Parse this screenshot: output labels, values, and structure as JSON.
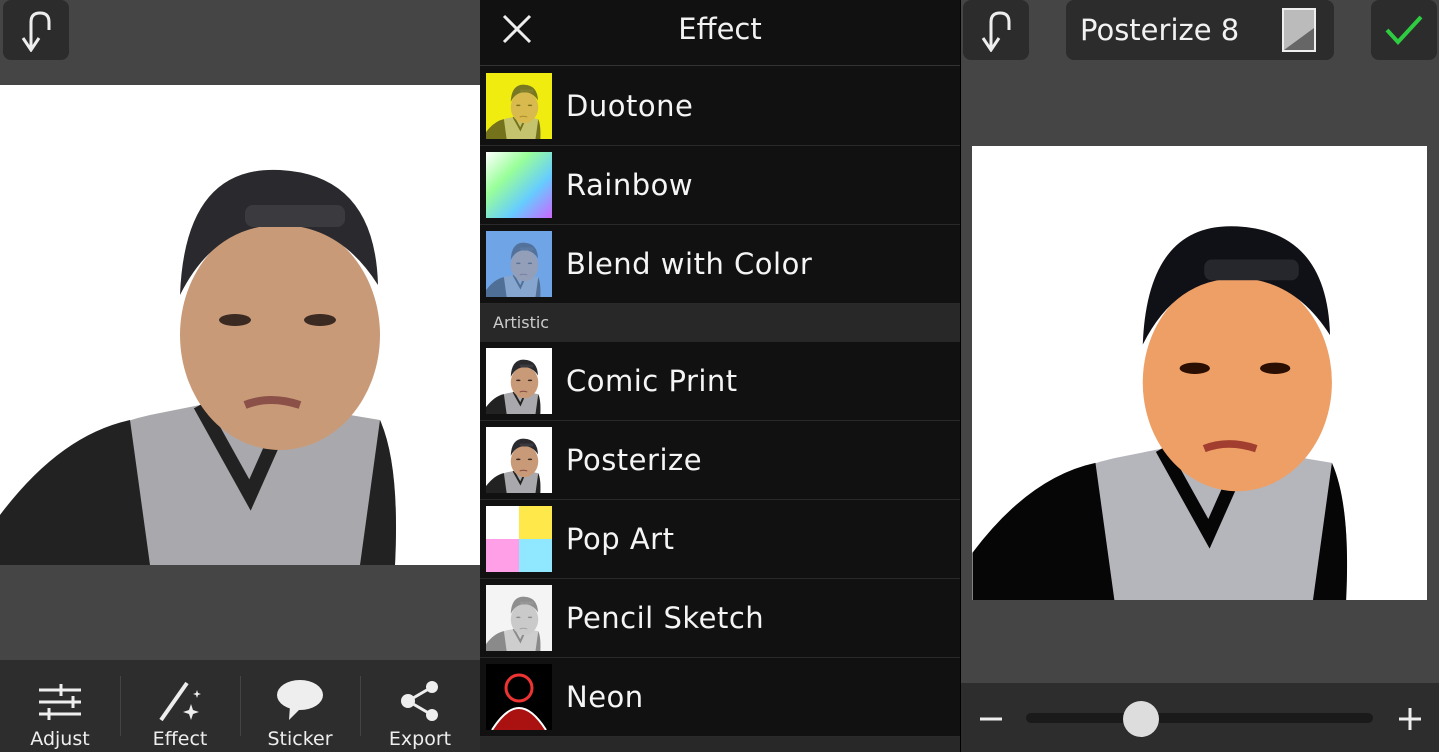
{
  "left": {
    "toolbar": [
      {
        "label": "Adjust",
        "icon": "sliders-icon"
      },
      {
        "label": "Effect",
        "icon": "magic-wand-icon"
      },
      {
        "label": "Sticker",
        "icon": "speech-bubble-icon"
      },
      {
        "label": "Export",
        "icon": "share-icon"
      }
    ]
  },
  "middle": {
    "title": "Effect",
    "items_top": [
      "Duotone",
      "Rainbow",
      "Blend with Color"
    ],
    "section": "Artistic",
    "items_artistic": [
      "Comic Print",
      "Posterize",
      "Pop Art",
      "Pencil Sketch",
      "Neon"
    ]
  },
  "right": {
    "effect_name": "Posterize 8",
    "slider": {
      "value": 8,
      "min": 1,
      "max": 32,
      "fraction": 0.33
    }
  },
  "colors": {
    "accent": "#2ecc40",
    "panel": "#454545",
    "bar": "#2d2d2d"
  }
}
